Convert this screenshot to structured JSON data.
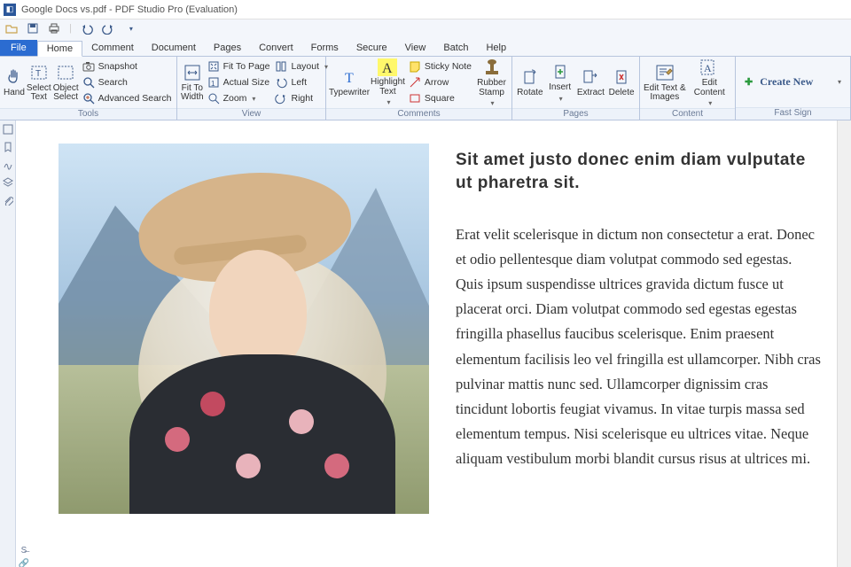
{
  "titlebar": {
    "title": "Google Docs vs.pdf - PDF Studio Pro (Evaluation)"
  },
  "menus": {
    "file": "File",
    "home": "Home",
    "comment": "Comment",
    "document": "Document",
    "pages": "Pages",
    "convert": "Convert",
    "forms": "Forms",
    "secure": "Secure",
    "view": "View",
    "batch": "Batch",
    "help": "Help"
  },
  "ribbon": {
    "tools": {
      "label": "Tools",
      "hand": "Hand",
      "select_text": "Select\nText",
      "object_select": "Object\nSelect",
      "snapshot": "Snapshot",
      "search": "Search",
      "advanced_search": "Advanced Search"
    },
    "view": {
      "label": "View",
      "fit_to_width": "Fit To\nWidth",
      "fit_to_page": "Fit To Page",
      "actual_size": "Actual Size",
      "zoom": "Zoom",
      "layout": "Layout",
      "left": "Left",
      "right": "Right"
    },
    "comments": {
      "label": "Comments",
      "typewriter": "Typewriter",
      "highlight_text": "Highlight\nText",
      "sticky_note": "Sticky Note",
      "arrow": "Arrow",
      "square": "Square",
      "rubber_stamp": "Rubber\nStamp"
    },
    "pages": {
      "label": "Pages",
      "rotate": "Rotate",
      "insert": "Insert",
      "extract": "Extract",
      "delete": "Delete"
    },
    "content": {
      "label": "Content",
      "edit_text_images": "Edit Text &\nImages",
      "edit_content": "Edit Content"
    },
    "fast_sign": {
      "label": "Fast Sign",
      "create_new": "Create New"
    }
  },
  "document": {
    "heading": "Sit amet justo donec enim diam vulputate ut pharetra sit.",
    "body": "Erat velit scelerisque in dictum non consectetur a erat. Donec et odio pellentesque diam volutpat commodo sed egestas. Quis ipsum suspendisse ultrices gravida dictum fusce ut placerat orci. Diam volutpat commodo sed egestas egestas fringilla phasellus faucibus scelerisque. Enim praesent elementum facilisis leo vel fringilla est ullamcorper. Nibh cras pulvinar mattis nunc sed. Ullamcorper dignissim cras tincidunt lobortis feugiat vivamus. In vitae turpis massa sed elementum tempus. Nisi scelerisque eu ultrices vitae. Neque aliquam vestibulum morbi blandit cursus risus at ultrices mi."
  }
}
